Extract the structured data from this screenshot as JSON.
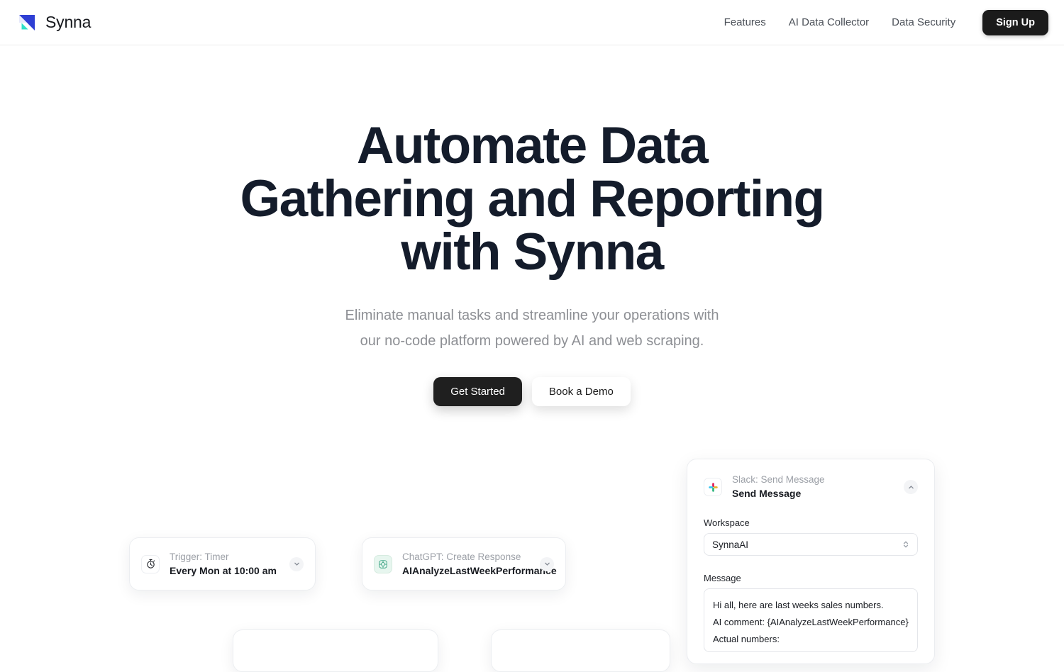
{
  "header": {
    "brand_name": "Synna",
    "logo_icon": "synna-triangle-logo",
    "nav": [
      {
        "label": "Features"
      },
      {
        "label": "AI Data Collector"
      },
      {
        "label": "Data Security"
      }
    ],
    "signup_label": "Sign Up"
  },
  "hero": {
    "title_line1": "Automate Data",
    "title_line2": "Gathering and Reporting",
    "title_line3": "with Synna",
    "subtitle": "Eliminate manual tasks and streamline your operations with our no-code platform powered by AI and web scraping.",
    "primary_cta": "Get Started",
    "secondary_cta": "Book a Demo"
  },
  "workflow": {
    "timer_card": {
      "icon": "stopwatch-icon",
      "kicker": "Trigger: Timer",
      "title": "Every Mon at 10:00 am"
    },
    "chatgpt_card": {
      "icon": "chatgpt-icon",
      "kicker": "ChatGPT: Create Response",
      "title": "AIAnalyzeLastWeekPerformance"
    },
    "slack_panel": {
      "icon": "slack-icon",
      "kicker": "Slack: Send Message",
      "title": "Send Message",
      "workspace_label": "Workspace",
      "workspace_value": "SynnaAI",
      "message_label": "Message",
      "message_lines": [
        "Hi all, here are last weeks sales numbers.",
        "AI comment: {AIAnalyzeLastWeekPerformance}",
        "Actual numbers:"
      ]
    }
  },
  "colors": {
    "brand_blue": "#2e3fd4",
    "brand_teal": "#2fe0c8",
    "headline": "#141c2b",
    "muted_text": "#8d8f94",
    "dark_button": "#1f1f1f",
    "slack_yellow": "#ecb22e",
    "slack_green": "#2eb67d",
    "slack_blue": "#36c5f0",
    "slack_red": "#e01e5a",
    "chatgpt_green": "#10a37f"
  }
}
